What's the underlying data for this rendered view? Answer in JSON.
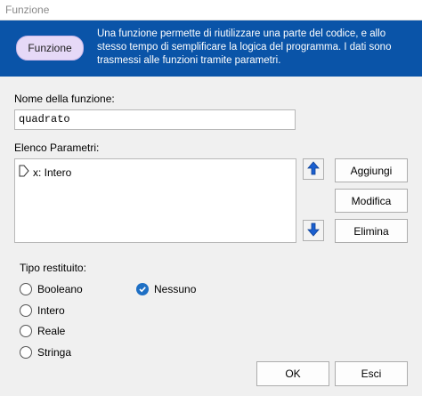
{
  "window": {
    "title": "Funzione"
  },
  "header": {
    "badge_label": "Funzione",
    "description": "Una funzione permette di riutilizzare una parte del codice, e allo stesso tempo di semplificare la logica del programma. I dati sono trasmessi alle funzioni tramite parametri."
  },
  "name_field": {
    "label": "Nome della funzione:",
    "value": "quadrato"
  },
  "params": {
    "label": "Elenco Parametri:",
    "items": [
      {
        "text": "x: Intero"
      }
    ]
  },
  "buttons": {
    "add": "Aggiungi",
    "edit": "Modifica",
    "delete": "Elimina",
    "ok": "OK",
    "cancel": "Esci"
  },
  "return_type": {
    "label": "Tipo restituito:",
    "options": [
      "Booleano",
      "Nessuno",
      "Intero",
      "Reale",
      "Stringa"
    ],
    "selected": "Nessuno"
  },
  "colors": {
    "header_bg": "#0a54a8",
    "badge_bg": "#e6d9f7",
    "radio_selected": "#1e6fc4",
    "arrow_blue": "#1a5fd0"
  }
}
